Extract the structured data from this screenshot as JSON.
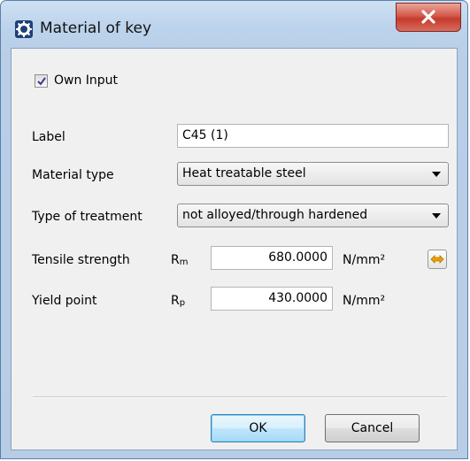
{
  "window": {
    "title": "Material of key",
    "icon": "gear-icon",
    "close_icon": "close-icon"
  },
  "own_input": {
    "label": "Own Input",
    "checked": true
  },
  "fields": {
    "label": {
      "caption": "Label",
      "value": "C45 (1)"
    },
    "material_type": {
      "caption": "Material type",
      "value": "Heat treatable steel"
    },
    "treatment": {
      "caption": "Type of treatment",
      "value": "not alloyed/through hardened"
    },
    "tensile": {
      "caption": "Tensile strength",
      "symbol_base": "R",
      "symbol_sub": "m",
      "value": "680.0000",
      "unit": "N/mm²",
      "action_icon": "convert-arrows-icon"
    },
    "yield": {
      "caption": "Yield point",
      "symbol_base": "R",
      "symbol_sub": "p",
      "value": "430.0000",
      "unit": "N/mm²"
    }
  },
  "buttons": {
    "ok": "OK",
    "cancel": "Cancel"
  },
  "colors": {
    "close_button": "#c43b2c",
    "default_button_border": "#3c7fb1",
    "convert_icon": "#f0a000"
  }
}
